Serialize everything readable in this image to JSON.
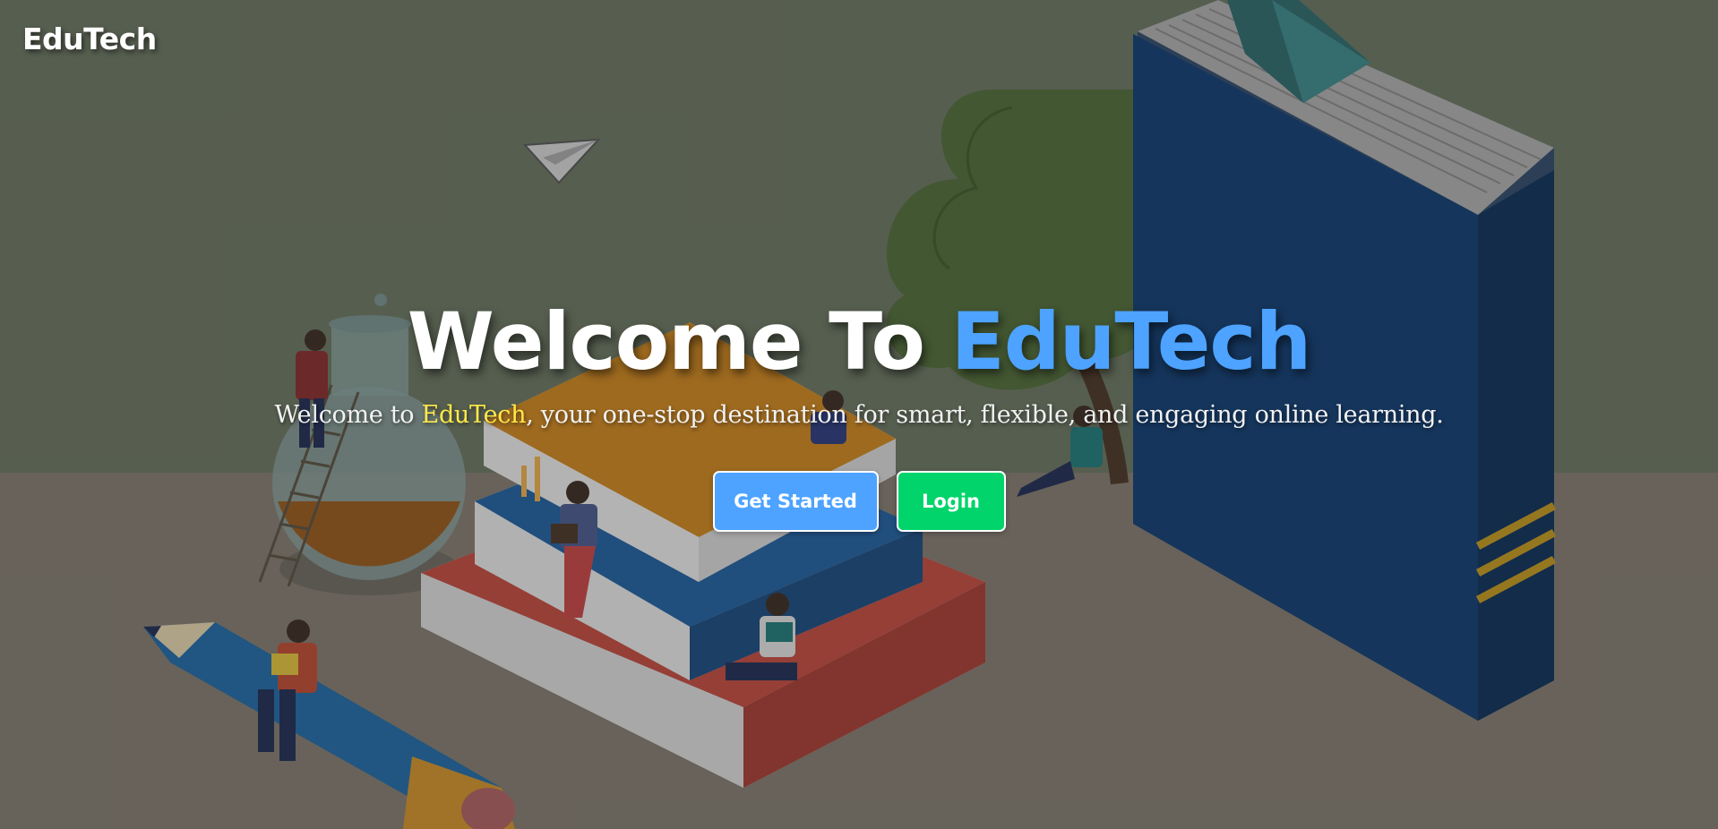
{
  "header": {
    "brand": "EduTech"
  },
  "hero": {
    "title_prefix": "Welcome To ",
    "title_highlight": "EduTech",
    "subtitle_prefix": "Welcome to ",
    "subtitle_brand": "EduTech",
    "subtitle_suffix": ", your one-stop destination for smart, flexible, and engaging online learning.",
    "background_illustration": "education-books-illustration"
  },
  "actions": {
    "get_started_label": "Get Started",
    "login_label": "Login"
  },
  "colors": {
    "accent_blue": "#4da3ff",
    "brand_yellow": "#ffe94a",
    "success_green": "#00d46a",
    "wall": "#6b7660",
    "floor": "#827a6e"
  }
}
